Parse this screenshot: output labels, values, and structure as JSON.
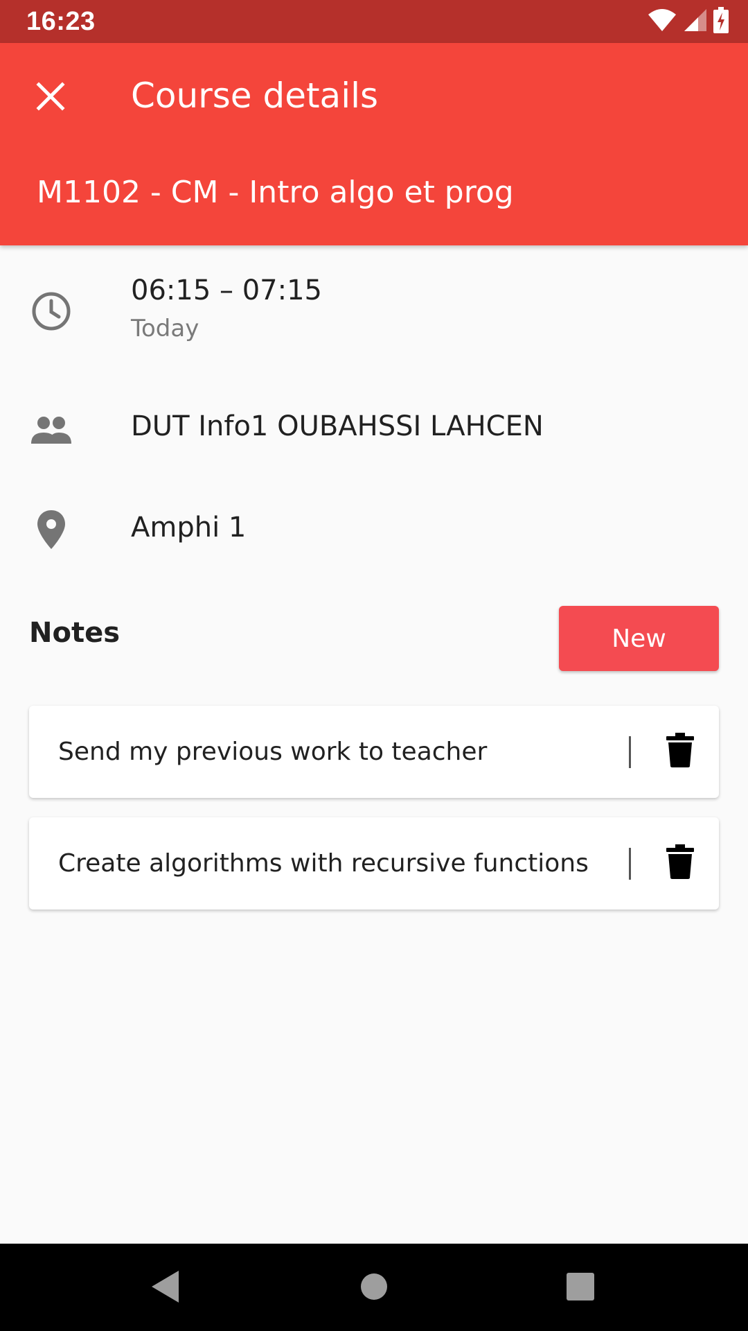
{
  "status_bar": {
    "time": "16:23",
    "icons": [
      "wifi-icon",
      "cell-signal-icon",
      "battery-charging-icon"
    ]
  },
  "app_bar": {
    "title": "Course details",
    "close_icon": "close-icon",
    "course_name": "M1102 - CM - Intro algo et prog",
    "color": "#f4453b"
  },
  "details": {
    "time_range": "06:15  –  07:15",
    "day": "Today",
    "group": "DUT Info1 OUBAHSSI LAHCEN",
    "location": "Amphi 1"
  },
  "notes": {
    "title": "Notes",
    "new_label": "New",
    "items": [
      {
        "text": "Send my previous work to teacher"
      },
      {
        "text": "Create algorithms with recursive functions"
      }
    ]
  },
  "nav_bar": {
    "icons": [
      "back-icon",
      "home-icon",
      "recents-icon"
    ]
  }
}
